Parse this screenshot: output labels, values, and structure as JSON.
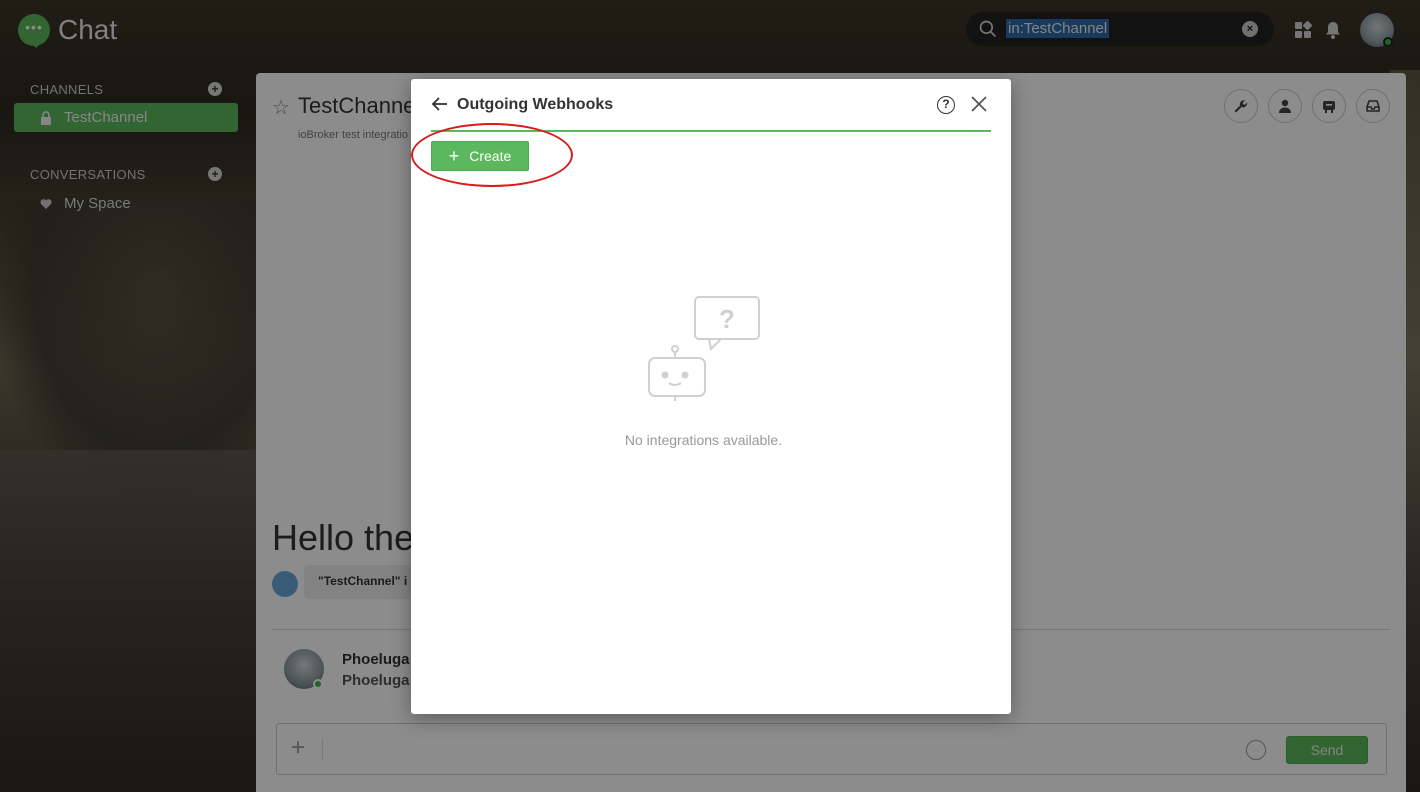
{
  "app": {
    "name": "Chat",
    "logo_glyph": "•••"
  },
  "header": {
    "search_value": "in:TestChannel",
    "search_clear_glyph": "×",
    "icons": [
      "apps-icon",
      "bell-icon"
    ]
  },
  "sidebar": {
    "channels_heading": "CHANNELS",
    "conversations_heading": "CONVERSATIONS",
    "add_glyph": "+",
    "channels": [
      {
        "label": "TestChannel",
        "icon": "lock-icon",
        "active": true
      }
    ],
    "conversations": [
      {
        "label": "My Space",
        "icon": "heart-icon"
      }
    ]
  },
  "channel": {
    "star_glyph": "☆",
    "title": "TestChanne",
    "subtitle": "ioBroker test integratio",
    "hello": "Hello the",
    "system_message": "\"TestChannel\" i",
    "message": {
      "author": "Phoeluga",
      "text": "Phoeluga"
    },
    "composer": {
      "plus_glyph": "+",
      "send_label": "Send"
    }
  },
  "modal": {
    "title": "Outgoing Webhooks",
    "help_glyph": "?",
    "create_label": "Create",
    "create_plus": "+",
    "empty_text": "No integrations available.",
    "accent_color": "#5cb85c",
    "highlight_color": "#d81b1b"
  }
}
